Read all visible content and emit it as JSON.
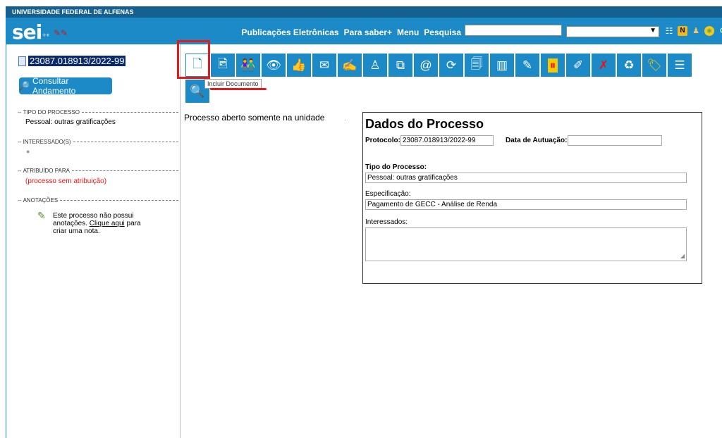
{
  "header": {
    "university": "UNIVERSIDADE FEDERAL DE ALFENAS",
    "logo": "sei",
    "logo_suffix": "++",
    "menu": [
      "Publicações Eletrônicas",
      "Para saber+",
      "Menu",
      "Pesquisa"
    ],
    "search_value": "",
    "unit_value": ""
  },
  "left": {
    "process_number": "23087.018913/2022-99",
    "consult_button": "Consultar Andamento",
    "sections": {
      "type_label": "TIPO DO PROCESSO",
      "type_value": "Pessoal: outras gratificações",
      "interested_label": "INTERESSADO(S)",
      "assigned_label": "ATRIBUÍDO PARA",
      "assigned_value": "(processo sem atribuição)",
      "notes_label": "ANOTAÇÕES",
      "notes_before": "Este processo não possui anotações. ",
      "notes_link": "Clique aqui",
      "notes_after": " para criar uma nota."
    }
  },
  "toolbar": {
    "tooltip": "Incluir Documento",
    "icons": [
      "include-document-icon",
      "include-related-icon",
      "send-process-icon",
      "view-icon",
      "approve-icon",
      "email-icon",
      "sign-icon",
      "assign-icon",
      "duplicate-icon",
      "send-email-icon",
      "update-icon",
      "print-icon",
      "units-icon",
      "comments-icon",
      "suspend-icon",
      "edit-icon",
      "cancel-icon",
      "recycle-icon",
      "tag-icon",
      "list-icon",
      "search-icon"
    ]
  },
  "main": {
    "open_message": "Processo aberto somente na unidade",
    "dados": {
      "title": "Dados do Processo",
      "protocol_label": "Protocolo:",
      "protocol_value": "23087.018913/2022-99",
      "date_label": "Data de Autuação:",
      "date_value": "",
      "type_label": "Tipo do Processo:",
      "type_value": "Pessoal: outras gratificações",
      "spec_label": "Especificação:",
      "spec_value": "Pagamento de GECC - Análise de Renda",
      "interested_label": "Interessados:"
    }
  },
  "colors": {
    "header_blue": "#1b8ac7",
    "dark_bar": "#155f91",
    "highlight_red": "#e01c1c",
    "selected_process_bg": "#0b2a6b"
  }
}
